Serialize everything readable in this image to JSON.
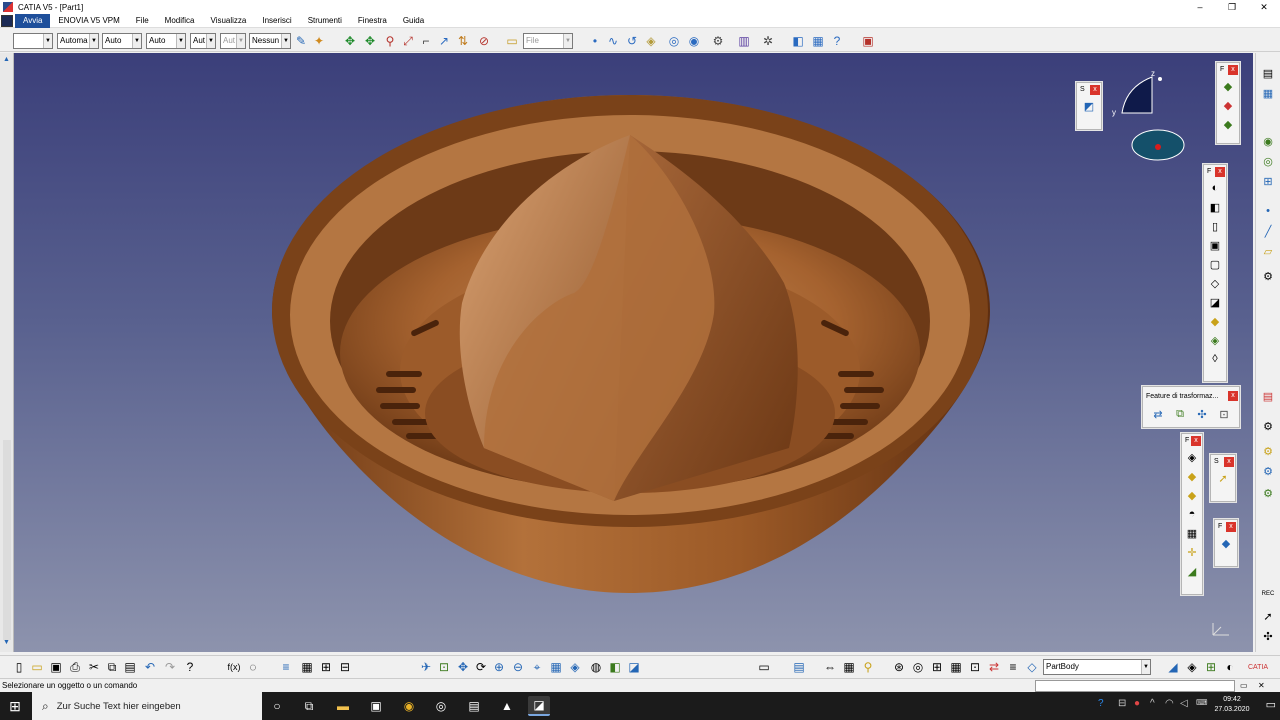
{
  "window": {
    "title": "CATIA V5 - [Part1]",
    "minimize": "–",
    "maximize": "❐",
    "close": "✕"
  },
  "menu": {
    "items": [
      "Avvia",
      "ENOVIA V5 VPM",
      "File",
      "Modifica",
      "Visualizza",
      "Inserisci",
      "Strumenti",
      "Finestra",
      "Guida"
    ]
  },
  "toolbar": {
    "combos": [
      {
        "value": ""
      },
      {
        "value": "Automa"
      },
      {
        "value": "Auto"
      },
      {
        "value": "Auto"
      },
      {
        "value": "Aut"
      },
      {
        "value": "Aut"
      },
      {
        "value": "Nessun"
      },
      {
        "value": "File"
      }
    ]
  },
  "panels": {
    "feature_transform_title": "Feature di trasformaz...",
    "s": "S",
    "f": "F",
    "close": "x"
  },
  "compass": {
    "z": "z",
    "y": "y"
  },
  "bottombar": {
    "partbody": "PartBody"
  },
  "status": {
    "message": "Selezionare un oggetto o un comando"
  },
  "taskbar": {
    "search_placeholder": "Zur Suche Text hier eingeben",
    "time": "09:42",
    "date": "27.03.2020"
  },
  "icons": {
    "new": "new-file-icon",
    "open": "open-folder-icon",
    "save": "save-icon",
    "print": "print-icon",
    "undo": "undo-icon",
    "pan": "pan-icon",
    "rotate": "rotate-icon",
    "zoom_in": "zoom-in-icon",
    "zoom_out": "zoom-out-icon"
  },
  "colors": {
    "viewport_top": "#3b3f7a",
    "viewport_bottom": "#8d93ad",
    "part": "#8a4f24",
    "menu_active": "#1e4f9b"
  }
}
